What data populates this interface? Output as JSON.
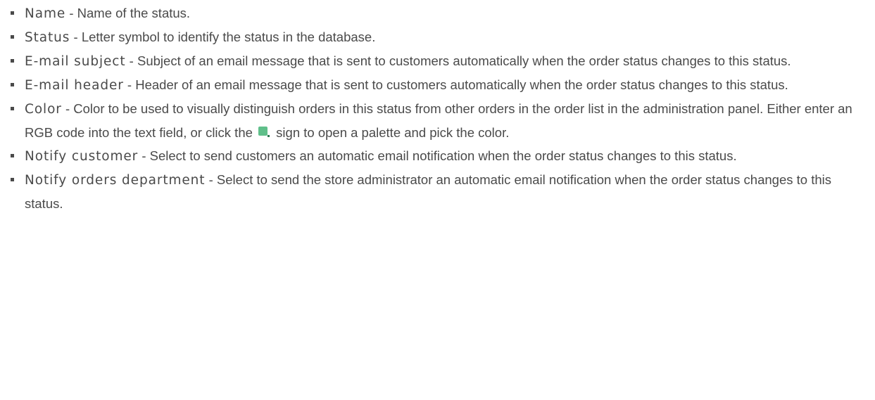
{
  "items": [
    {
      "term": "Name",
      "sep": " - ",
      "desc": "Name of the status."
    },
    {
      "term": "Status",
      "sep": " - ",
      "desc": "Letter symbol to identify the status in the database."
    },
    {
      "term": "E-mail subject",
      "sep": " - ",
      "desc": "Subject of an email message that is sent to customers automatically when the order status changes to this status."
    },
    {
      "term": "E-mail header",
      "sep": " - ",
      "desc": "Header of an email message that is sent to customers automatically when the order status changes to this status."
    },
    {
      "term": "Color",
      "sep": " - ",
      "desc_before_icon": "Color to be used to visually distinguish orders in this status from other orders in the order list in the administration panel. Either enter an RGB code into the text field, or click the",
      "desc_after_icon": " sign to open a palette and pick the color.",
      "icon": "color-palette-icon"
    },
    {
      "term": "Notify customer",
      "sep": " - ",
      "desc": "Select to send customers an automatic email notification when the order status changes to this status."
    },
    {
      "term": "Notify orders department",
      "sep": " - ",
      "desc": "Select to send the store administrator an automatic email notification when the order status changes to this status."
    }
  ],
  "colors": {
    "text": "#4a4a4a",
    "palette_icon": "#5fbf8a"
  }
}
